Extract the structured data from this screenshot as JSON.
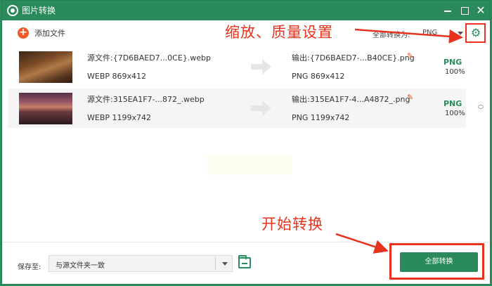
{
  "window": {
    "title": "图片转换",
    "controls": [
      "minimize",
      "maximize",
      "close"
    ]
  },
  "toolbar": {
    "add_files_label": "添加文件",
    "convert_all_label": "全部转换为:",
    "format_selected": "PNG"
  },
  "annotations": {
    "settings_note": "缩放、质量设置",
    "start_note": "开始转换"
  },
  "files": [
    {
      "source_label": "源文件:",
      "source_name": "{7D6BAED7...0CE}.webp",
      "source_format": "WEBP",
      "source_size": "869x412",
      "output_label": "输出:",
      "output_name": "{7D6BAED7-...B40CE}.png",
      "output_format": "PNG",
      "output_size": "869x412",
      "target_format": "PNG",
      "quality": "100%"
    },
    {
      "source_label": "源文件:",
      "source_name": "315EA1F7-...872_.webp",
      "source_format": "WEBP",
      "source_size": "1199x742",
      "output_label": "输出:",
      "output_name": "315EA1F7-4...A4872_.png",
      "output_format": "PNG",
      "output_size": "1199x742",
      "target_format": "PNG",
      "quality": "100%"
    }
  ],
  "footer": {
    "save_to_label": "保存至:",
    "save_to_value": "与源文件夹一致",
    "convert_button_label": "全部转换"
  },
  "colors": {
    "brand": "#2b8a5c",
    "accent": "#f15a29",
    "annotation": "#e8321e"
  },
  "icons": [
    "app-logo-icon",
    "add-icon",
    "gear-icon",
    "arrow-right-icon",
    "edit-icon",
    "folder-icon",
    "chevron-up-icon",
    "chevron-down-icon"
  ]
}
